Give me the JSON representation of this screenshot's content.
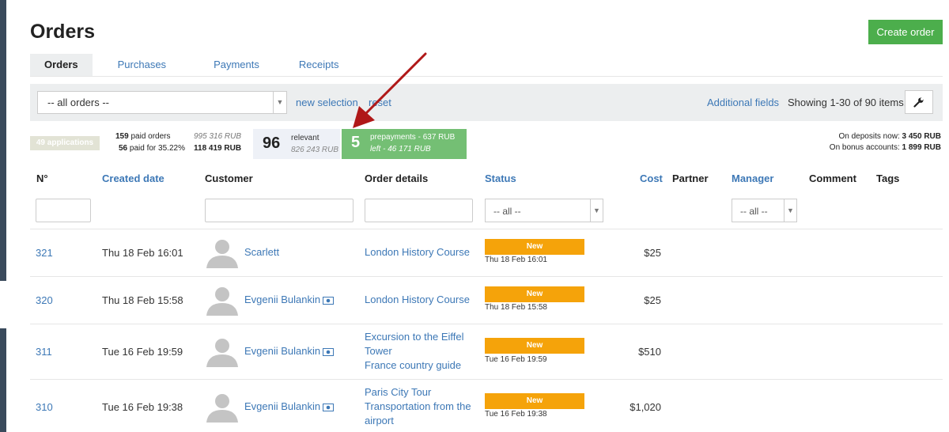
{
  "page": {
    "title": "Orders",
    "create_label": "Create order"
  },
  "tabs": [
    "Orders",
    "Purchases",
    "Payments",
    "Receipts"
  ],
  "filterbar": {
    "select_value": "-- all orders --",
    "new_selection": "new selection",
    "reset": "reset",
    "additional_fields": "Additional fields",
    "showing": "Showing 1-30 of 90 items."
  },
  "stats": {
    "applications": "49 applications",
    "paid_orders_count": "159",
    "paid_orders_label": "paid orders",
    "paid_orders_sum": "995 316 RUB",
    "paid_for_count": "56",
    "paid_for_label": "paid for 35.22%",
    "paid_for_sum": "118 419 RUB",
    "relevant_count": "96",
    "relevant_label": "relevant",
    "relevant_sum": "826 243 RUB",
    "prepay_count": "5",
    "prepay_label": "prepayments - 637 RUB",
    "prepay_left": "left - 46 171 RUB",
    "deposits_label": "On deposits now:",
    "deposits_value": "3 450 RUB",
    "bonus_label": "On bonus accounts:",
    "bonus_value": "1 899 RUB"
  },
  "table": {
    "headers": {
      "num": "N°",
      "created": "Created date",
      "customer": "Customer",
      "details": "Order details",
      "status": "Status",
      "cost": "Cost",
      "partner": "Partner",
      "manager": "Manager",
      "comment": "Comment",
      "tags": "Tags"
    },
    "status_filter": "-- all --",
    "manager_filter": "-- all --",
    "rows": [
      {
        "num": "321",
        "date": "Thu 18 Feb 16:01",
        "customer": "Scarlett",
        "card": false,
        "details": [
          "London History Course"
        ],
        "status": "New",
        "status_date": "Thu 18 Feb 16:01",
        "cost": "$25"
      },
      {
        "num": "320",
        "date": "Thu 18 Feb 15:58",
        "customer": "Evgenii Bulankin",
        "card": true,
        "details": [
          "London History Course"
        ],
        "status": "New",
        "status_date": "Thu 18 Feb 15:58",
        "cost": "$25"
      },
      {
        "num": "311",
        "date": "Tue 16 Feb 19:59",
        "customer": "Evgenii Bulankin",
        "card": true,
        "details": [
          "Excursion to the Eiffel Tower",
          "France country guide"
        ],
        "status": "New",
        "status_date": "Tue 16 Feb 19:59",
        "cost": "$510"
      },
      {
        "num": "310",
        "date": "Tue 16 Feb 19:38",
        "customer": "Evgenii Bulankin",
        "card": true,
        "details": [
          "Paris City Tour",
          "Transportation from the airport"
        ],
        "status": "New",
        "status_date": "Tue 16 Feb 19:38",
        "cost": "$1,020"
      }
    ]
  },
  "colors": {
    "link": "#3d78b6",
    "accent_green": "#4cae4c",
    "status_new": "#f5a30a",
    "arrow": "#b01818"
  }
}
